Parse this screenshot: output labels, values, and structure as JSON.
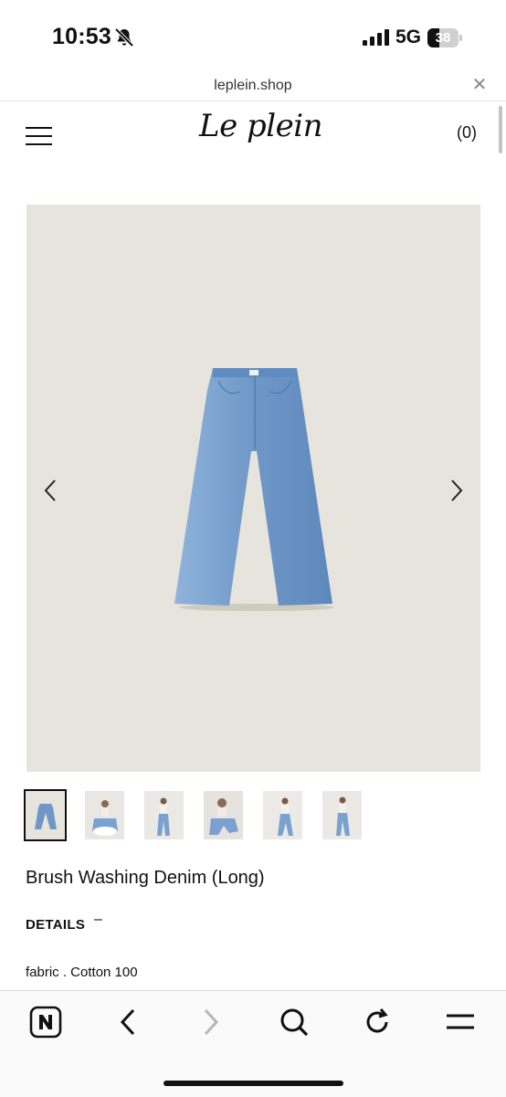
{
  "status_bar": {
    "time": "10:53",
    "network": "5G",
    "battery_level": "38",
    "battery_fraction": 0.38,
    "icons": [
      "bell-muted-icon",
      "signal-icon",
      "battery-icon"
    ]
  },
  "browser": {
    "url": "leplein.shop",
    "close_icon": "close-icon"
  },
  "site": {
    "logo_text": "Le plein",
    "menu_icon": "hamburger-icon",
    "cart_count": "(0)"
  },
  "product": {
    "image_bg": "#e7e4dd",
    "denim_color": "#6f98c8",
    "thumbnail_count": 6,
    "selected_thumbnail": 1,
    "title": "Brush Washing Denim (Long)",
    "details_label": "DETAILS",
    "details_toggle": "–",
    "fabric": "fabric . Cotton 100"
  },
  "toolbar": {
    "icons": [
      "naver-n-icon",
      "back-icon",
      "forward-icon",
      "search-icon",
      "reload-icon",
      "menu-icon"
    ]
  }
}
